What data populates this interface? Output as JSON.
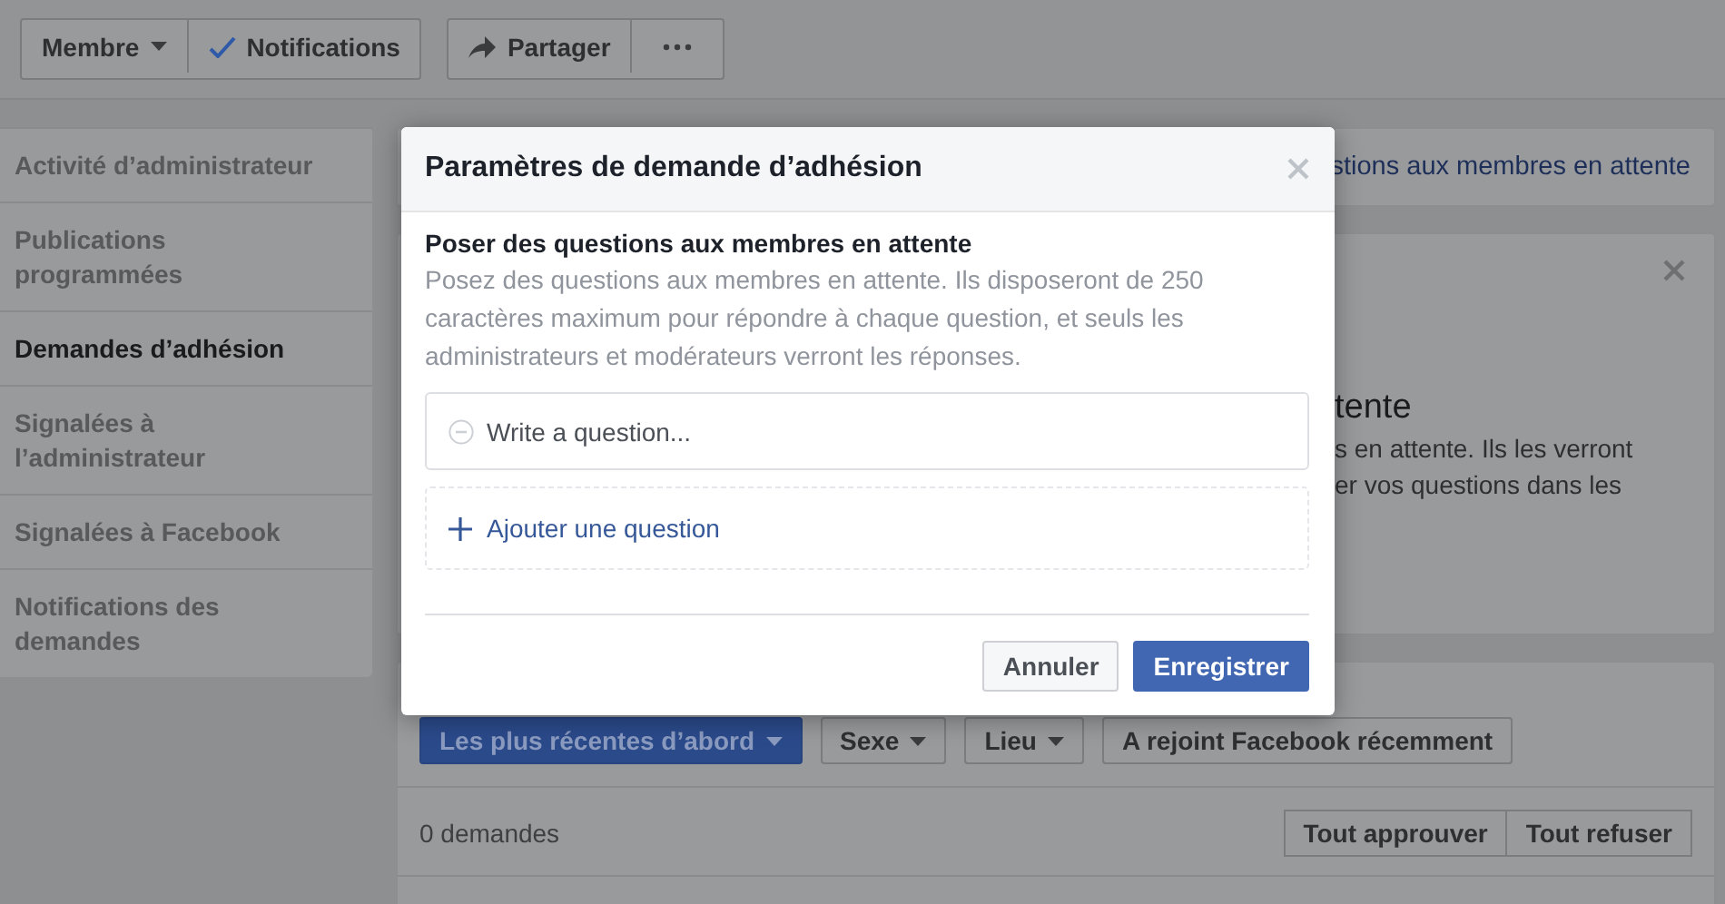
{
  "toolbar": {
    "groups": [
      {
        "buttons": [
          {
            "kind": "dropdown",
            "label": "Membre"
          },
          {
            "kind": "check",
            "label": "Notifications"
          }
        ]
      },
      {
        "buttons": [
          {
            "kind": "share",
            "label": "Partager"
          },
          {
            "kind": "more"
          }
        ]
      }
    ]
  },
  "sidebar": {
    "items": [
      {
        "label": "Activité d’administrateur",
        "selected": false
      },
      {
        "label": "Publications programmées",
        "selected": false
      },
      {
        "label": "Demandes d’adhésion",
        "selected": true
      },
      {
        "label": "Signalées à l’administrateur",
        "selected": false
      },
      {
        "label": "Signalées à Facebook",
        "selected": false
      },
      {
        "label": "Notifications des demandes",
        "selected": false
      }
    ]
  },
  "link_banner": {
    "link": "stions aux membres en attente"
  },
  "info_card": {
    "heading": "tente",
    "lines": [
      "s en attente. Ils les verront",
      "er vos questions dans les"
    ]
  },
  "filters": [
    {
      "kind": "primary-dropdown",
      "label": "Les plus récentes d’abord"
    },
    {
      "kind": "dropdown",
      "label": "Sexe"
    },
    {
      "kind": "dropdown",
      "label": "Lieu"
    },
    {
      "kind": "plain",
      "label": "A rejoint Facebook récemment"
    }
  ],
  "requests": {
    "count": "0 demandes",
    "actions": [
      "Tout approuver",
      "Tout refuser"
    ]
  },
  "modal": {
    "title": "Paramètres de demande d’adhésion",
    "section_title": "Poser des questions aux membres en attente",
    "description": "Posez des questions aux membres en attente. Ils disposeront de 250 caractères maximum pour répondre à chaque question, et seuls les administrateurs et modérateurs verront les réponses.",
    "question_field": {
      "placeholder": "Write a question..."
    },
    "add_question": "Ajouter une question",
    "buttons": [
      {
        "kind": "secondary",
        "label": "Annuler"
      },
      {
        "kind": "primary",
        "label": "Enregistrer"
      }
    ]
  }
}
